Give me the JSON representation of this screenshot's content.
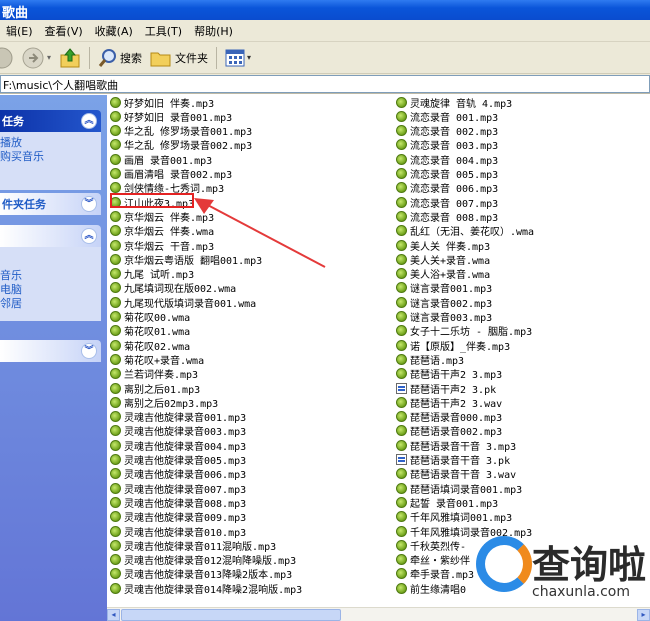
{
  "window": {
    "title": "歌曲"
  },
  "menu": [
    "辑(E)",
    "查看(V)",
    "收藏(A)",
    "工具(T)",
    "帮助(H)"
  ],
  "toolbar": {
    "search_label": "搜索",
    "folders_label": "文件夹"
  },
  "address": {
    "value": "F:\\music\\个人翻唱歌曲"
  },
  "taskpane": {
    "music_tasks": {
      "title": "任务",
      "links": [
        "播放",
        "购买音乐"
      ]
    },
    "folder_tasks": {
      "title": "件夹任务"
    },
    "other_places": {
      "links": [
        "音乐",
        "电脑",
        "邻居"
      ]
    }
  },
  "files": [
    {
      "name": "好梦如旧 伴奏.mp3",
      "icon": "music"
    },
    {
      "name": "好梦如旧 录音001.mp3",
      "icon": "music"
    },
    {
      "name": "华之乱 修罗场录音001.mp3",
      "icon": "music"
    },
    {
      "name": "华之乱 修罗场录音002.mp3",
      "icon": "music"
    },
    {
      "name": "画眉 录音001.mp3",
      "icon": "music"
    },
    {
      "name": "画眉清唱 录音002.mp3",
      "icon": "music"
    },
    {
      "name": "剑侠情缘-七秀词.mp3",
      "icon": "music"
    },
    {
      "name": "江山此夜3.mp3",
      "icon": "music"
    },
    {
      "name": "京华烟云 伴奏.mp3",
      "icon": "music"
    },
    {
      "name": "京华烟云 伴奏.wma",
      "icon": "music"
    },
    {
      "name": "京华烟云 干音.mp3",
      "icon": "music"
    },
    {
      "name": "京华烟云粤语版 翻唱001.mp3",
      "icon": "music"
    },
    {
      "name": "九尾 试听.mp3",
      "icon": "music"
    },
    {
      "name": "九尾填词现在版002.wma",
      "icon": "music"
    },
    {
      "name": "九尾现代版填词录音001.wma",
      "icon": "music"
    },
    {
      "name": "菊花叹00.wma",
      "icon": "music"
    },
    {
      "name": "菊花叹01.wma",
      "icon": "music"
    },
    {
      "name": "菊花叹02.wma",
      "icon": "music"
    },
    {
      "name": "菊花叹+录音.wma",
      "icon": "music"
    },
    {
      "name": "兰若词伴奏.mp3",
      "icon": "music"
    },
    {
      "name": "离别之后01.mp3",
      "icon": "music"
    },
    {
      "name": "离别之后02mp3.mp3",
      "icon": "music"
    },
    {
      "name": "灵魂吉他旋律录音001.mp3",
      "icon": "music"
    },
    {
      "name": "灵魂吉他旋律录音003.mp3",
      "icon": "music"
    },
    {
      "name": "灵魂吉他旋律录音004.mp3",
      "icon": "music"
    },
    {
      "name": "灵魂吉他旋律录音005.mp3",
      "icon": "music"
    },
    {
      "name": "灵魂吉他旋律录音006.mp3",
      "icon": "music"
    },
    {
      "name": "灵魂吉他旋律录音007.mp3",
      "icon": "music"
    },
    {
      "name": "灵魂吉他旋律录音008.mp3",
      "icon": "music"
    },
    {
      "name": "灵魂吉他旋律录音009.mp3",
      "icon": "music"
    },
    {
      "name": "灵魂吉他旋律录音010.mp3",
      "icon": "music"
    },
    {
      "name": "灵魂吉他旋律录音011混响版.mp3",
      "icon": "music"
    },
    {
      "name": "灵魂吉他旋律录音012混响降噪版.mp3",
      "icon": "music"
    },
    {
      "name": "灵魂吉他旋律录音013降噪2版本.mp3",
      "icon": "music"
    },
    {
      "name": "灵魂吉他旋律录音014降噪2混响版.mp3",
      "icon": "music"
    },
    {
      "name": "灵魂旋律 音轨 4.mp3",
      "icon": "music"
    },
    {
      "name": "流恋录音 001.mp3",
      "icon": "music"
    },
    {
      "name": "流恋录音 002.mp3",
      "icon": "music"
    },
    {
      "name": "流恋录音 003.mp3",
      "icon": "music"
    },
    {
      "name": "流恋录音 004.mp3",
      "icon": "music"
    },
    {
      "name": "流恋录音 005.mp3",
      "icon": "music"
    },
    {
      "name": "流恋录音 006.mp3",
      "icon": "music"
    },
    {
      "name": "流恋录音 007.mp3",
      "icon": "music"
    },
    {
      "name": "流恋录音 008.mp3",
      "icon": "music"
    },
    {
      "name": "乱红（无泪、姜花叹）.wma",
      "icon": "music"
    },
    {
      "name": "美人关 伴奏.mp3",
      "icon": "music"
    },
    {
      "name": "美人关+录音.wma",
      "icon": "music"
    },
    {
      "name": "美人浴+录音.wma",
      "icon": "music"
    },
    {
      "name": "谜言录音001.mp3",
      "icon": "music"
    },
    {
      "name": "谜言录音002.mp3",
      "icon": "music"
    },
    {
      "name": "谜言录音003.mp3",
      "icon": "music"
    },
    {
      "name": "女子十二乐坊 - 胭脂.mp3",
      "icon": "music"
    },
    {
      "name": "诺【原版】_伴奏.mp3",
      "icon": "music"
    },
    {
      "name": "琵琶语.mp3",
      "icon": "music"
    },
    {
      "name": "琵琶语干声2 3.mp3",
      "icon": "music"
    },
    {
      "name": "琵琶语干声2 3.pk",
      "icon": "doc"
    },
    {
      "name": "琵琶语干声2 3.wav",
      "icon": "music"
    },
    {
      "name": "琵琶语录音000.mp3",
      "icon": "music"
    },
    {
      "name": "琵琶语录音002.mp3",
      "icon": "music"
    },
    {
      "name": "琵琶语录音干音 3.mp3",
      "icon": "music"
    },
    {
      "name": "琵琶语录音干音 3.pk",
      "icon": "doc"
    },
    {
      "name": "琵琶语录音干音 3.wav",
      "icon": "music"
    },
    {
      "name": "琵琶语填词录音001.mp3",
      "icon": "music"
    },
    {
      "name": "起誓 录音001.mp3",
      "icon": "music"
    },
    {
      "name": "千年风雅填词001.mp3",
      "icon": "music"
    },
    {
      "name": "千年风雅填词录音002.mp3",
      "icon": "music"
    },
    {
      "name": "千秋英烈传-",
      "icon": "music"
    },
    {
      "name": "牵丝・紫纱伴",
      "icon": "music"
    },
    {
      "name": "牵手录音.mp3",
      "icon": "music"
    },
    {
      "name": "前生缘清唱0",
      "icon": "music"
    }
  ],
  "watermark": {
    "text": "查询啦",
    "url": "chaxunla.com"
  }
}
